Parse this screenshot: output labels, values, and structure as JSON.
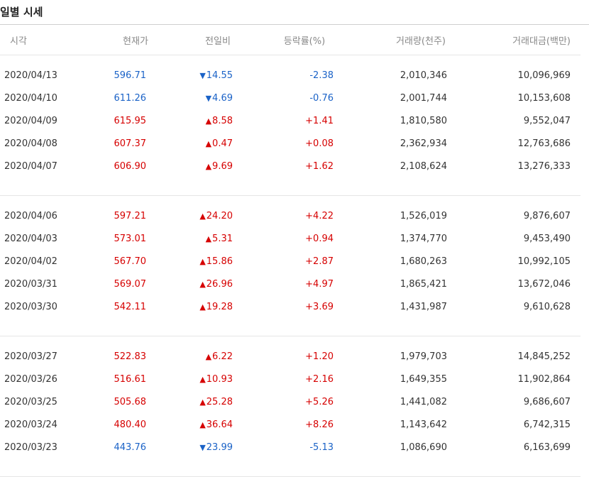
{
  "title": "일별 시세",
  "columns": [
    "시각",
    "현재가",
    "전일비",
    "등락률(%)",
    "거래량(천주)",
    "거래대금(백만)"
  ],
  "colors": {
    "up": "#d60000",
    "down": "#1a62c7"
  },
  "groups": [
    [
      {
        "date": "2020/04/13",
        "price": "596.71",
        "dir": "down",
        "arrow": "▼",
        "change": "14.55",
        "rate": "-2.38",
        "volume": "2,010,346",
        "amount": "10,096,969"
      },
      {
        "date": "2020/04/10",
        "price": "611.26",
        "dir": "down",
        "arrow": "▼",
        "change": "4.69",
        "rate": "-0.76",
        "volume": "2,001,744",
        "amount": "10,153,608"
      },
      {
        "date": "2020/04/09",
        "price": "615.95",
        "dir": "up",
        "arrow": "▲",
        "change": "8.58",
        "rate": "+1.41",
        "volume": "1,810,580",
        "amount": "9,552,047"
      },
      {
        "date": "2020/04/08",
        "price": "607.37",
        "dir": "up",
        "arrow": "▲",
        "change": "0.47",
        "rate": "+0.08",
        "volume": "2,362,934",
        "amount": "12,763,686"
      },
      {
        "date": "2020/04/07",
        "price": "606.90",
        "dir": "up",
        "arrow": "▲",
        "change": "9.69",
        "rate": "+1.62",
        "volume": "2,108,624",
        "amount": "13,276,333"
      }
    ],
    [
      {
        "date": "2020/04/06",
        "price": "597.21",
        "dir": "up",
        "arrow": "▲",
        "change": "24.20",
        "rate": "+4.22",
        "volume": "1,526,019",
        "amount": "9,876,607"
      },
      {
        "date": "2020/04/03",
        "price": "573.01",
        "dir": "up",
        "arrow": "▲",
        "change": "5.31",
        "rate": "+0.94",
        "volume": "1,374,770",
        "amount": "9,453,490"
      },
      {
        "date": "2020/04/02",
        "price": "567.70",
        "dir": "up",
        "arrow": "▲",
        "change": "15.86",
        "rate": "+2.87",
        "volume": "1,680,263",
        "amount": "10,992,105"
      },
      {
        "date": "2020/03/31",
        "price": "569.07",
        "dir": "up",
        "arrow": "▲",
        "change": "26.96",
        "rate": "+4.97",
        "volume": "1,865,421",
        "amount": "13,672,046"
      },
      {
        "date": "2020/03/30",
        "price": "542.11",
        "dir": "up",
        "arrow": "▲",
        "change": "19.28",
        "rate": "+3.69",
        "volume": "1,431,987",
        "amount": "9,610,628"
      }
    ],
    [
      {
        "date": "2020/03/27",
        "price": "522.83",
        "dir": "up",
        "arrow": "▲",
        "change": "6.22",
        "rate": "+1.20",
        "volume": "1,979,703",
        "amount": "14,845,252"
      },
      {
        "date": "2020/03/26",
        "price": "516.61",
        "dir": "up",
        "arrow": "▲",
        "change": "10.93",
        "rate": "+2.16",
        "volume": "1,649,355",
        "amount": "11,902,864"
      },
      {
        "date": "2020/03/25",
        "price": "505.68",
        "dir": "up",
        "arrow": "▲",
        "change": "25.28",
        "rate": "+5.26",
        "volume": "1,441,082",
        "amount": "9,686,607"
      },
      {
        "date": "2020/03/24",
        "price": "480.40",
        "dir": "up",
        "arrow": "▲",
        "change": "36.64",
        "rate": "+8.26",
        "volume": "1,143,642",
        "amount": "6,742,315"
      },
      {
        "date": "2020/03/23",
        "price": "443.76",
        "dir": "down",
        "arrow": "▼",
        "change": "23.99",
        "rate": "-5.13",
        "volume": "1,086,690",
        "amount": "6,163,699"
      }
    ]
  ]
}
